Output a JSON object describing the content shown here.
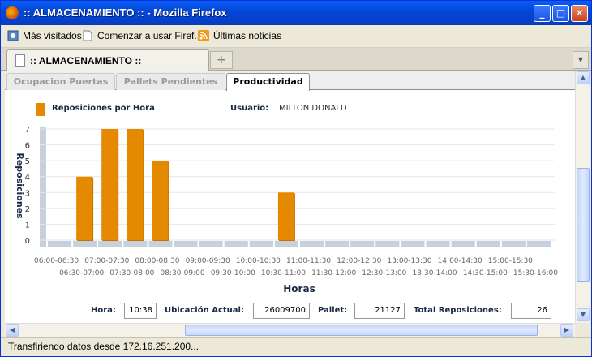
{
  "window": {
    "title": ":: ALMACENAMIENTO :: - Mozilla Firefox",
    "minimize_glyph": "_",
    "maximize_glyph": "□",
    "close_glyph": "✕"
  },
  "bookmarks": [
    {
      "label": "Más visitados",
      "icon": "bookmark-icon"
    },
    {
      "label": "Comenzar a usar Firef...",
      "icon": "page-icon"
    },
    {
      "label": "Últimas noticias",
      "icon": "rss-icon"
    }
  ],
  "browser_tab": {
    "label": ":: ALMACENAMIENTO ::",
    "new_tab_glyph": "✛",
    "list_glyph": "▼"
  },
  "app_tabs": [
    {
      "label": "Ocupacion Puertas",
      "active": false
    },
    {
      "label": "Pallets Pendientes",
      "active": false
    },
    {
      "label": "Productividad",
      "active": true
    }
  ],
  "legend_label": "Reposiciones por Hora",
  "user": {
    "label": "Usuario:",
    "value": "MILTON DONALD"
  },
  "chart_data": {
    "type": "bar",
    "title": "",
    "xlabel": "Horas",
    "ylabel": "Reposiciones",
    "ylim": [
      0,
      7
    ],
    "yticks": [
      "0",
      "1",
      "2",
      "3",
      "4",
      "5",
      "6",
      "7"
    ],
    "bar_color": "#e58a00",
    "baseline_color": "#c7d0dd",
    "categories": [
      "06:00-06:30",
      "06:30-07:00",
      "07:00-07:30",
      "07:30-08:00",
      "08:00-08:30",
      "08:30-09:00",
      "09:00-09:30",
      "09:30-10:00",
      "10:00-10:30",
      "10:30-11:00",
      "11:00-11:30",
      "11:30-12:00",
      "12:00-12:30",
      "12:30-13:00",
      "13:00-13:30",
      "13:30-14:00",
      "14:00-14:30",
      "14:30-15:00",
      "15:00-15:30",
      "15:30-16:00"
    ],
    "series": [
      {
        "name": "Reposiciones por Hora",
        "values": [
          0,
          4,
          7,
          7,
          5,
          0,
          0,
          0,
          0,
          3,
          0,
          0,
          0,
          0,
          0,
          0,
          0,
          0,
          0,
          0
        ]
      }
    ]
  },
  "footer": {
    "hora_label": "Hora:",
    "hora_value": "10:38",
    "ubicacion_label": "Ubicación Actual:",
    "ubicacion_value": "26009700",
    "pallet_label": "Pallet:",
    "pallet_value": "21127",
    "total_label": "Total Reposiciones:",
    "total_value": "26"
  },
  "scroll": {
    "up": "▲",
    "down": "▼",
    "left": "◀",
    "right": "▶"
  },
  "status": "Transfiriendo datos desde 172.16.251.200..."
}
